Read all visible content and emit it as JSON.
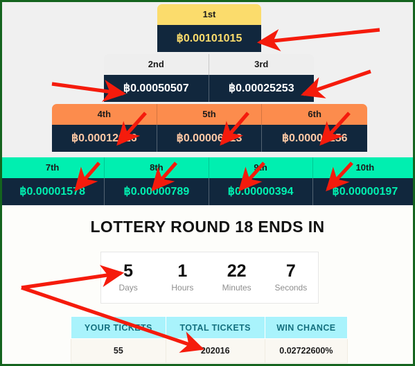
{
  "prizes": {
    "tier1": [
      {
        "place": "1st",
        "amount": "฿0.00101015"
      }
    ],
    "tier2": [
      {
        "place": "2nd",
        "amount": "฿0.00050507"
      },
      {
        "place": "3rd",
        "amount": "฿0.00025253"
      }
    ],
    "tier3": [
      {
        "place": "4th",
        "amount": "฿0.00012626"
      },
      {
        "place": "5th",
        "amount": "฿0.00006313"
      },
      {
        "place": "6th",
        "amount": "฿0.00003156"
      }
    ],
    "tier4": [
      {
        "place": "7th",
        "amount": "฿0.00001578"
      },
      {
        "place": "8th",
        "amount": "฿0.00000789"
      },
      {
        "place": "9th",
        "amount": "฿0.00000394"
      },
      {
        "place": "10th",
        "amount": "฿0.00000197"
      }
    ]
  },
  "round": {
    "title": "LOTTERY ROUND 18 ENDS IN",
    "number": "18"
  },
  "countdown": {
    "units": [
      {
        "value": "5",
        "label": "Days"
      },
      {
        "value": "1",
        "label": "Hours"
      },
      {
        "value": "22",
        "label": "Minutes"
      },
      {
        "value": "7",
        "label": "Seconds"
      }
    ]
  },
  "tickets_table": {
    "headers": [
      "YOUR TICKETS",
      "TOTAL TICKETS",
      "WIN CHANCE"
    ],
    "row": [
      "55",
      "202016",
      "0.02722600%"
    ]
  },
  "colors": {
    "tier1_header": "#fbdc6c",
    "tier2_header": "#eeeeee",
    "tier3_header": "#fc8c4d",
    "tier4_header": "#00efb0",
    "value_background": "#11273d",
    "table_header": "#a9f3fc",
    "page_border": "#14641e",
    "annotation_arrow": "#f51b0c"
  },
  "annotations": {
    "arrow_color": "#f51b0c",
    "arrow_count": 12,
    "icon": "arrow-icon"
  }
}
